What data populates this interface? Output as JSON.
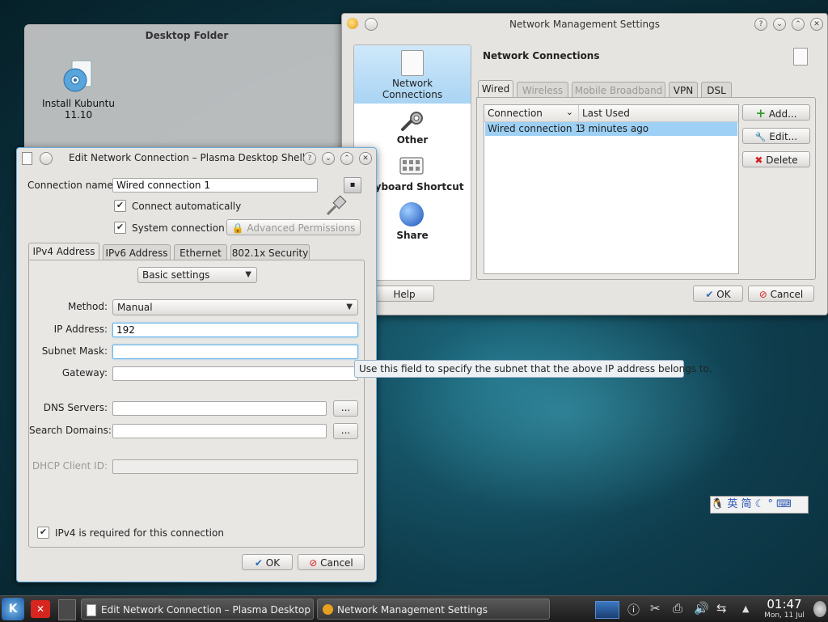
{
  "desktop_folder": {
    "title": "Desktop Folder",
    "icon_label_line1": "Install Kubuntu",
    "icon_label_line2": "11.10"
  },
  "nm_settings": {
    "title": "Network Management Settings",
    "categories": [
      {
        "label_line1": "Network",
        "label_line2": "Connections"
      },
      {
        "label_line1": "Other"
      },
      {
        "label_line1": "Keyboard Shortcut"
      },
      {
        "label_line1": "Share"
      }
    ],
    "heading": "Network Connections",
    "tabs": [
      "Wired",
      "Wireless",
      "Mobile Broadband",
      "VPN",
      "DSL"
    ],
    "columns": [
      "Connection",
      "Last Used"
    ],
    "rows": [
      {
        "connection": "Wired connection 1",
        "last_used": "3 minutes ago"
      }
    ],
    "add_label": "Add...",
    "edit_label": "Edit...",
    "delete_label": "Delete",
    "help_label": "Help",
    "ok_label": "OK",
    "cancel_label": "Cancel"
  },
  "edit_dialog": {
    "title": "Edit Network Connection – Plasma Desktop Shell",
    "connection_name_label": "Connection name:",
    "connection_name_value": "Wired connection 1",
    "connect_auto_label": "Connect automatically",
    "system_conn_label": "System connection",
    "advanced_perm_label": "Advanced Permissions",
    "tabs": [
      "IPv4 Address",
      "IPv6 Address",
      "Ethernet",
      "802.1x Security"
    ],
    "basic_settings": "Basic settings",
    "method_label": "Method:",
    "method_value": "Manual",
    "ip_label": "IP Address:",
    "ip_value": "192",
    "subnet_label": "Subnet Mask:",
    "subnet_value": "",
    "gateway_label": "Gateway:",
    "gateway_value": "",
    "dns_label": "DNS Servers:",
    "dns_value": "",
    "search_label": "Search Domains:",
    "search_value": "",
    "dhcp_label": "DHCP Client ID:",
    "dhcp_value": "",
    "browse_label": "...",
    "ipv4_required_label": "IPv4 is required for this connection",
    "ok_label": "OK",
    "cancel_label": "Cancel"
  },
  "tooltip": "Use this field to specify the subnet that the above IP address belongs to.",
  "input_method_bar": [
    "英",
    "简"
  ],
  "taskbar": {
    "tasks": [
      "Edit Network Connection – Plasma Desktop Shell",
      "Network Management Settings"
    ],
    "time": "01:47",
    "date": "Mon, 11 Jul"
  },
  "colors": {
    "selection": "#9dd0f4",
    "focus_border": "#68b4e6",
    "delete_icon": "#d42020",
    "add_icon": "#2f9b2f"
  }
}
